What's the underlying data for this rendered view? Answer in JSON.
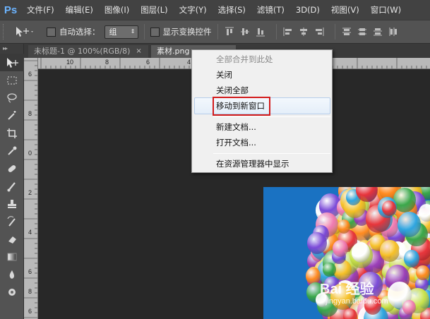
{
  "app": {
    "logo": "Ps"
  },
  "menubar": {
    "items": [
      "文件(F)",
      "编辑(E)",
      "图像(I)",
      "图层(L)",
      "文字(Y)",
      "选择(S)",
      "滤镜(T)",
      "3D(D)",
      "视图(V)",
      "窗口(W)"
    ]
  },
  "options": {
    "auto_select_label": "自动选择：",
    "auto_select_value": "组",
    "show_transform_label": "显示变换控件"
  },
  "tabs": [
    {
      "label": "未标题-1 @ 100%(RGB/8)",
      "close": "×"
    },
    {
      "label": "素材.png",
      "close": "×"
    }
  ],
  "ruler": {
    "h_labels": [
      "10",
      "8",
      "6",
      "4"
    ],
    "v_labels": [
      "6",
      "8",
      "0",
      "2",
      "4",
      "6",
      "8",
      "6"
    ]
  },
  "context_menu": {
    "items": [
      {
        "label": "全部合并到此处",
        "disabled": true
      },
      {
        "label": "关闭",
        "disabled": false
      },
      {
        "label": "关闭全部",
        "disabled": false
      },
      {
        "label": "移动到新窗口",
        "disabled": false,
        "highlighted": true
      },
      {
        "label": "新建文档...",
        "disabled": false
      },
      {
        "label": "打开文档...",
        "disabled": false
      },
      {
        "label": "在资源管理器中显示",
        "disabled": false
      }
    ]
  },
  "watermark": {
    "text": "Bai 经验",
    "sub": "jingyan.baidu.com"
  },
  "colors": {
    "menubar": "#424242",
    "panel": "#535353",
    "canvas": "#282828",
    "photo_sky": "#1a72c2",
    "highlight": "#d31b1b"
  }
}
